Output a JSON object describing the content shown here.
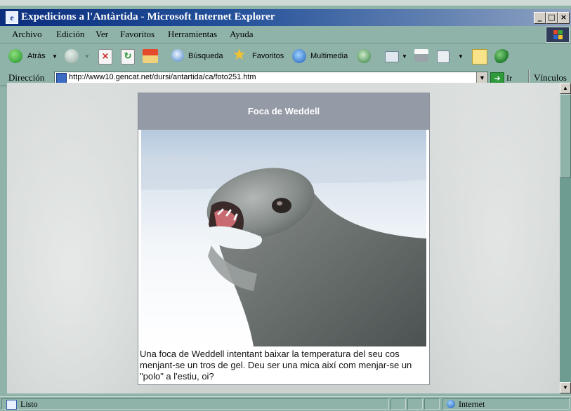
{
  "window": {
    "title": "Expedicions a l'Antàrtida - Microsoft Internet Explorer",
    "min_label": "_",
    "max_label": "□",
    "close_label": "×"
  },
  "menu": [
    {
      "label": "Archivo"
    },
    {
      "label": "Edición"
    },
    {
      "label": "Ver"
    },
    {
      "label": "Favoritos"
    },
    {
      "label": "Herramientas"
    },
    {
      "label": "Ayuda"
    }
  ],
  "toolbar": {
    "back_label": "Atrás",
    "search_label": "Búsqueda",
    "favorites_label": "Favoritos",
    "media_label": "Multimedia"
  },
  "address": {
    "label": "Dirección",
    "url": "http://www10.gencat.net/dursi/antartida/ca/foto251.htm",
    "go_label": "Ir",
    "links_label": "Vínculos"
  },
  "page": {
    "photo_title": "Foca de Weddell",
    "caption": "Una foca de Weddell intentant baixar la temperatura del seu cos menjant-se un tros de gel. Deu ser una mica així com menjar-se un \"polo\" a l'estiu, oi?"
  },
  "status": {
    "text": "Listo",
    "zone": "Internet"
  }
}
